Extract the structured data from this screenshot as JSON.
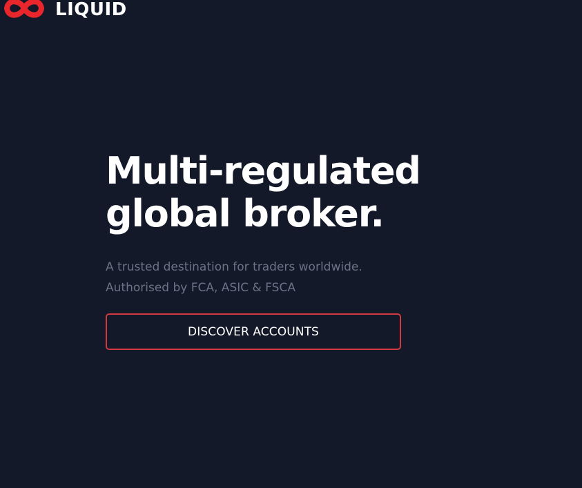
{
  "brand": {
    "name": "LIQUID",
    "logo_icon": "infinity-icon",
    "accent_color": "#e8262c"
  },
  "hero": {
    "title_line1": "Multi-regulated",
    "title_line2": "global broker.",
    "subtitle_line1": "A trusted destination for traders worldwide.",
    "subtitle_line2": "Authorised by FCA, ASIC & FSCA"
  },
  "cta": {
    "label": "DISCOVER ACCOUNTS",
    "border_color": "#d23a3f"
  },
  "theme": {
    "background": "#131928",
    "subtitle_color": "#6b7385"
  }
}
